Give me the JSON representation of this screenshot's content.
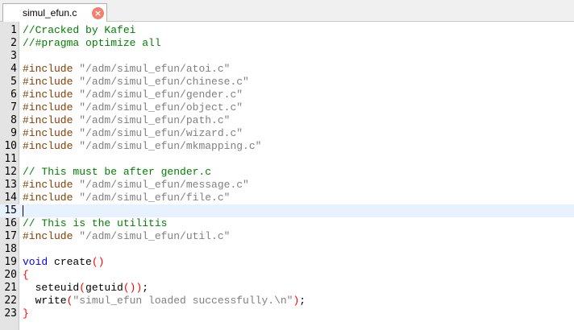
{
  "tab": {
    "title": "simul_efun.c",
    "close_glyph": "×"
  },
  "editor": {
    "current_line": 15,
    "lines": [
      {
        "n": "1",
        "tokens": [
          {
            "t": "//Cracked by Kafei",
            "c": "comment"
          }
        ]
      },
      {
        "n": "2",
        "tokens": [
          {
            "t": "//#pragma optimize all",
            "c": "comment"
          }
        ]
      },
      {
        "n": "3",
        "tokens": []
      },
      {
        "n": "4",
        "tokens": [
          {
            "t": "#include ",
            "c": "preproc"
          },
          {
            "t": "\"/adm/simul_efun/atoi.c\"",
            "c": "string"
          }
        ]
      },
      {
        "n": "5",
        "tokens": [
          {
            "t": "#include ",
            "c": "preproc"
          },
          {
            "t": "\"/adm/simul_efun/chinese.c\"",
            "c": "string"
          }
        ]
      },
      {
        "n": "6",
        "tokens": [
          {
            "t": "#include ",
            "c": "preproc"
          },
          {
            "t": "\"/adm/simul_efun/gender.c\"",
            "c": "string"
          }
        ]
      },
      {
        "n": "7",
        "tokens": [
          {
            "t": "#include ",
            "c": "preproc"
          },
          {
            "t": "\"/adm/simul_efun/object.c\"",
            "c": "string"
          }
        ]
      },
      {
        "n": "8",
        "tokens": [
          {
            "t": "#include ",
            "c": "preproc"
          },
          {
            "t": "\"/adm/simul_efun/path.c\"",
            "c": "string"
          }
        ]
      },
      {
        "n": "9",
        "tokens": [
          {
            "t": "#include ",
            "c": "preproc"
          },
          {
            "t": "\"/adm/simul_efun/wizard.c\"",
            "c": "string"
          }
        ]
      },
      {
        "n": "10",
        "tokens": [
          {
            "t": "#include ",
            "c": "preproc"
          },
          {
            "t": "\"/adm/simul_efun/mkmapping.c\"",
            "c": "string"
          }
        ]
      },
      {
        "n": "11",
        "tokens": []
      },
      {
        "n": "12",
        "tokens": [
          {
            "t": "// This must be after gender.c",
            "c": "comment"
          }
        ]
      },
      {
        "n": "13",
        "tokens": [
          {
            "t": "#include ",
            "c": "preproc"
          },
          {
            "t": "\"/adm/simul_efun/message.c\"",
            "c": "string"
          }
        ]
      },
      {
        "n": "14",
        "tokens": [
          {
            "t": "#include ",
            "c": "preproc"
          },
          {
            "t": "\"/adm/simul_efun/file.c\"",
            "c": "string"
          }
        ]
      },
      {
        "n": "15",
        "tokens": []
      },
      {
        "n": "16",
        "tokens": [
          {
            "t": "// This is the utilitis",
            "c": "comment"
          }
        ]
      },
      {
        "n": "17",
        "tokens": [
          {
            "t": "#include ",
            "c": "preproc"
          },
          {
            "t": "\"/adm/simul_efun/util.c\"",
            "c": "string"
          }
        ]
      },
      {
        "n": "18",
        "tokens": []
      },
      {
        "n": "19",
        "tokens": [
          {
            "t": "void",
            "c": "keyword"
          },
          {
            "t": " create",
            "c": ""
          },
          {
            "t": "()",
            "c": "paren"
          }
        ]
      },
      {
        "n": "20",
        "tokens": [
          {
            "t": "{",
            "c": "paren"
          }
        ]
      },
      {
        "n": "21",
        "tokens": [
          {
            "t": "  seteuid",
            "c": ""
          },
          {
            "t": "(",
            "c": "paren"
          },
          {
            "t": "getuid",
            "c": ""
          },
          {
            "t": "())",
            "c": "paren"
          },
          {
            "t": ";",
            "c": ""
          }
        ]
      },
      {
        "n": "22",
        "tokens": [
          {
            "t": "  write",
            "c": ""
          },
          {
            "t": "(",
            "c": "paren"
          },
          {
            "t": "\"simul_efun loaded successfully.\\n\"",
            "c": "string"
          },
          {
            "t": ")",
            "c": "paren"
          },
          {
            "t": ";",
            "c": ""
          }
        ]
      },
      {
        "n": "23",
        "tokens": [
          {
            "t": "}",
            "c": "paren"
          }
        ]
      }
    ]
  }
}
